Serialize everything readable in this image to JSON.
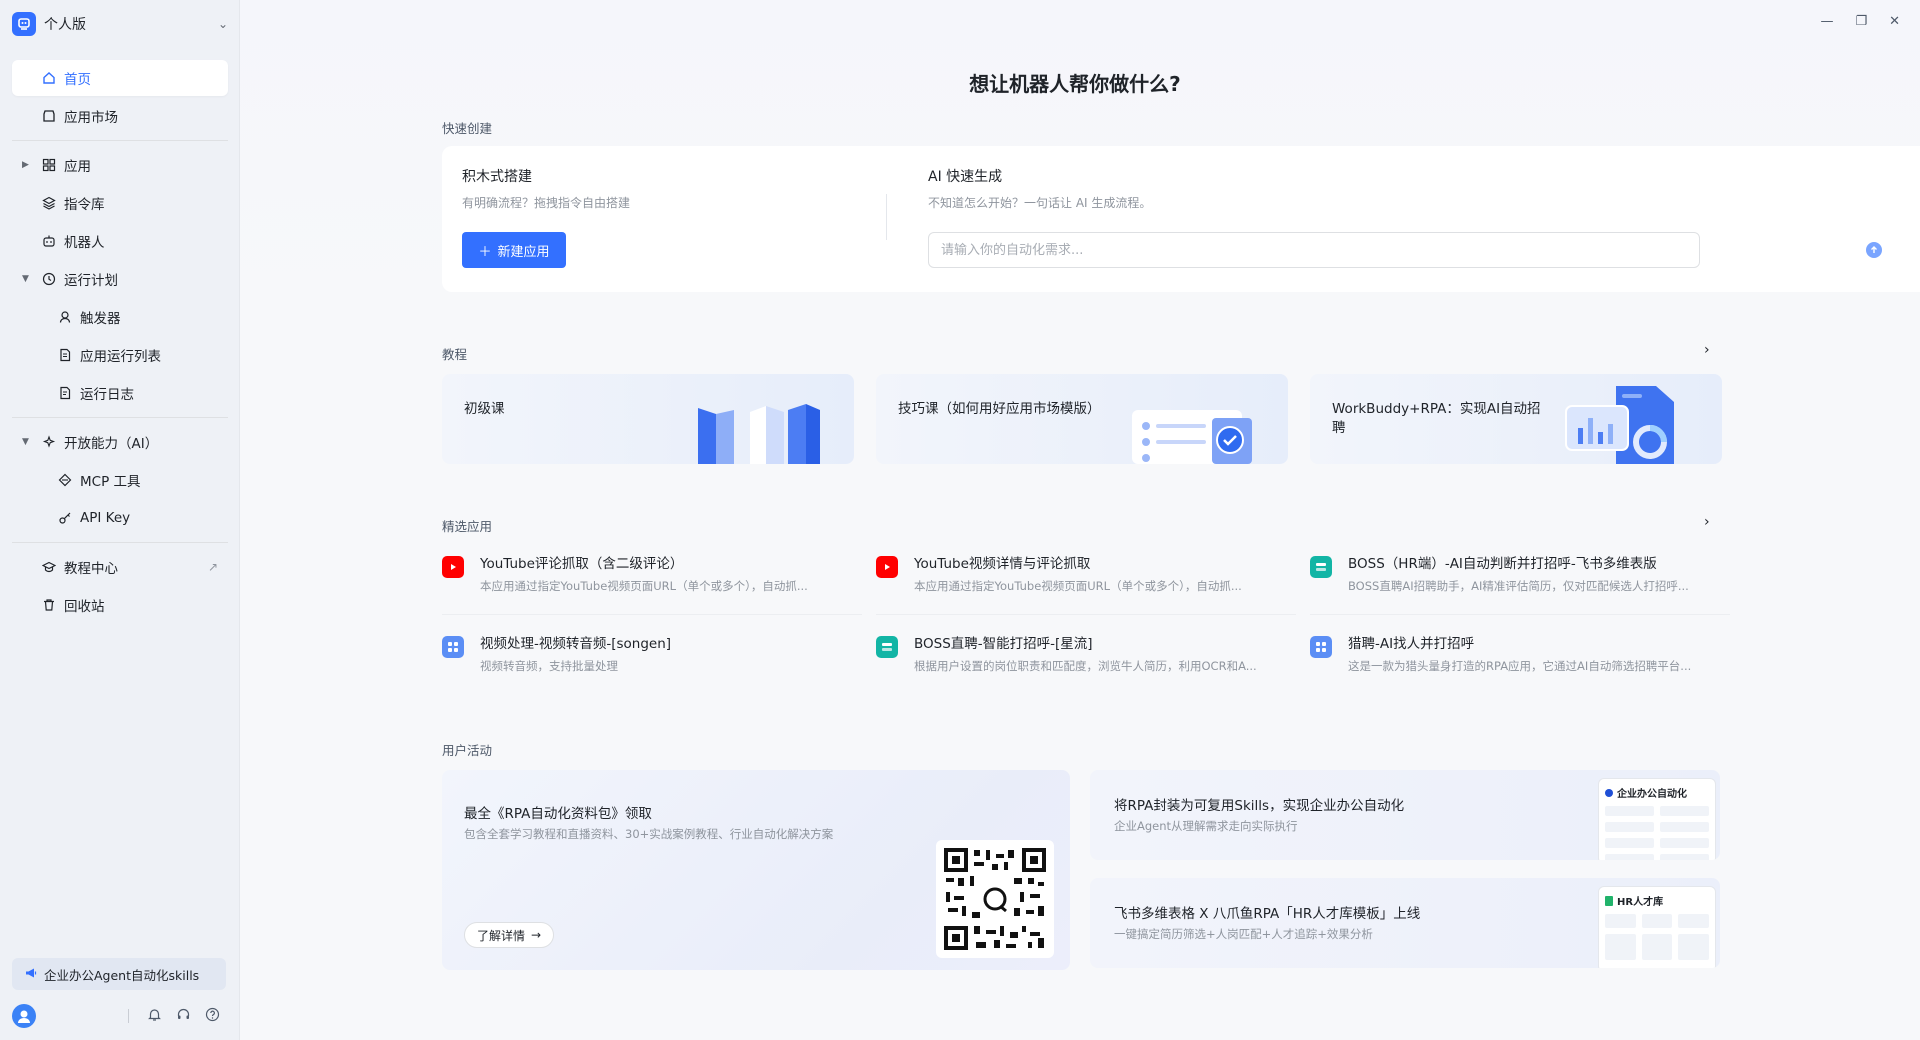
{
  "sidebar": {
    "brand": "个人版",
    "items": [
      {
        "label": "首页"
      },
      {
        "label": "应用市场"
      },
      {
        "label": "应用"
      },
      {
        "label": "指令库"
      },
      {
        "label": "机器人"
      },
      {
        "label": "运行计划"
      },
      {
        "label": "触发器"
      },
      {
        "label": "应用运行列表"
      },
      {
        "label": "运行日志"
      },
      {
        "label": "开放能力（AI）"
      },
      {
        "label": "MCP 工具"
      },
      {
        "label": "API Key"
      },
      {
        "label": "教程中心"
      },
      {
        "label": "回收站"
      }
    ],
    "promo": "企业办公Agent自动化skills"
  },
  "main": {
    "hero_title": "想让机器人帮你做什么?",
    "quick": {
      "label": "快速创建",
      "left_title": "积木式搭建",
      "left_sub": "有明确流程？拖拽指令自由搭建",
      "new_button": "新建应用",
      "right_title": "AI 快速生成",
      "right_sub": "不知道怎么开始？一句话让 AI 生成流程。",
      "input_placeholder": "请输入你的自动化需求..."
    },
    "tutorials": {
      "label": "教程",
      "cards": [
        {
          "title": "初级课"
        },
        {
          "title": "技巧课（如何用好应用市场模版）"
        },
        {
          "title": "WorkBuddy+RPA：实现AI自动招聘"
        }
      ]
    },
    "featured": {
      "label": "精选应用",
      "apps": [
        {
          "title": "YouTube评论抓取（含二级评论）",
          "desc": "本应用通过指定YouTube视频页面URL（单个或多个），自动抓..."
        },
        {
          "title": "YouTube视频详情与评论抓取",
          "desc": "本应用通过指定YouTube视频页面URL（单个或多个），自动抓..."
        },
        {
          "title": "BOSS（HR端）-AI自动判断并打招呼-飞书多维表版",
          "desc": "BOSS直聘AI招聘助手，AI精准评估简历，仅对匹配候选人打招呼..."
        },
        {
          "title": "视频处理-视频转音频-[songen]",
          "desc": "视频转音频，支持批量处理"
        },
        {
          "title": "BOSS直聘-智能打招呼-[星流]",
          "desc": "根据用户设置的岗位职责和匹配度，浏览牛人简历，利用OCR和A..."
        },
        {
          "title": "猎聘-AI找人并打招呼",
          "desc": "这是一款为猎头量身打造的RPA应用，它通过AI自动筛选招聘平台..."
        }
      ]
    },
    "activities": {
      "label": "用户活动",
      "big": {
        "title": "最全《RPA自动化资料包》领取",
        "sub": "包含全套学习教程和直播资料、30+实战案例教程、行业自动化解决方案",
        "button": "了解详情"
      },
      "small": [
        {
          "title": "将RPA封装为可复用Skills，实现企业办公自动化",
          "sub": "企业Agent从理解需求走向实际执行",
          "thumb_title": "企业办公自动化"
        },
        {
          "title": "飞书多维表格 X 八爪鱼RPA「HR人才库模板」上线",
          "sub": "一键搞定简历筛选+人岗匹配+人才追踪+效果分析",
          "thumb_title": "HR人才库"
        }
      ]
    }
  },
  "colors": {
    "accent": "#3370ff",
    "youtube": "#ff0000",
    "boss": "#12b5a5"
  }
}
